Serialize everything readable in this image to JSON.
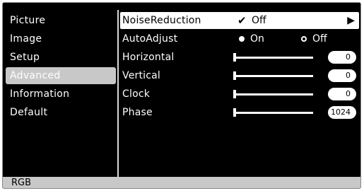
{
  "menu": {
    "items": [
      {
        "label": "Picture",
        "active": false
      },
      {
        "label": "Image",
        "active": false
      },
      {
        "label": "Setup",
        "active": false
      },
      {
        "label": "Advanced",
        "active": true
      },
      {
        "label": "Information",
        "active": false
      },
      {
        "label": "Default",
        "active": false
      }
    ]
  },
  "panel": {
    "noise_reduction": {
      "label": "NoiseReduction",
      "value": "Off",
      "check": "✔",
      "arrow": "▶"
    },
    "auto_adjust": {
      "label": "AutoAdjust",
      "option_on": "On",
      "option_off": "Off",
      "selected": "On"
    },
    "horizontal": {
      "label": "Horizontal",
      "value": "0"
    },
    "vertical": {
      "label": "Vertical",
      "value": "0"
    },
    "clock": {
      "label": "Clock",
      "value": "0"
    },
    "phase": {
      "label": "Phase",
      "value": "1024"
    }
  },
  "footer": {
    "source": "RGB"
  },
  "colors": {
    "background": "#000000",
    "highlight": "#c8c8c8",
    "text": "#ffffff"
  }
}
